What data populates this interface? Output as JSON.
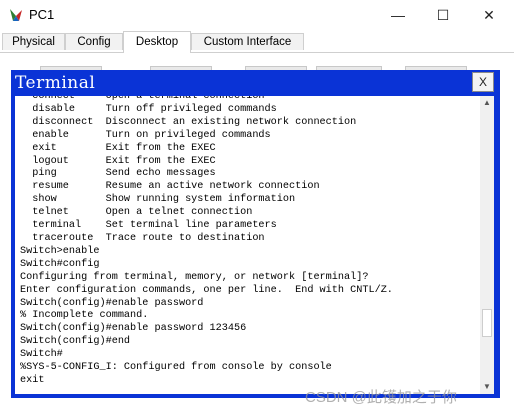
{
  "window": {
    "title": "PC1",
    "minimize_glyph": "—",
    "maximize_glyph": "☐",
    "close_glyph": "✕",
    "icon": "pc-app-icon"
  },
  "tabs": [
    {
      "label": "Physical",
      "active": false
    },
    {
      "label": "Config",
      "active": false
    },
    {
      "label": "Desktop",
      "active": true
    },
    {
      "label": "Custom Interface",
      "active": false
    }
  ],
  "terminal": {
    "title": "Terminal",
    "close_label": "X",
    "title_bar_color": "#0a33d6",
    "output": "  connect     Open a terminal connection\n  disable     Turn off privileged commands\n  disconnect  Disconnect an existing network connection\n  enable      Turn on privileged commands\n  exit        Exit from the EXEC\n  logout      Exit from the EXEC\n  ping        Send echo messages\n  resume      Resume an active network connection\n  show        Show running system information\n  telnet      Open a telnet connection\n  terminal    Set terminal line parameters\n  traceroute  Trace route to destination\nSwitch>enable\nSwitch#config\nConfiguring from terminal, memory, or network [terminal]?\nEnter configuration commands, one per line.  End with CNTL/Z.\nSwitch(config)#enable password\n% Incomplete command.\nSwitch(config)#enable password 123456\nSwitch(config)#end\nSwitch#\n%SYS-5-CONFIG_I: Configured from console by console\nexit"
  },
  "scrollbar": {
    "up_glyph": "▲",
    "down_glyph": "▼"
  },
  "watermark": "CSDN @此镬加之于你"
}
